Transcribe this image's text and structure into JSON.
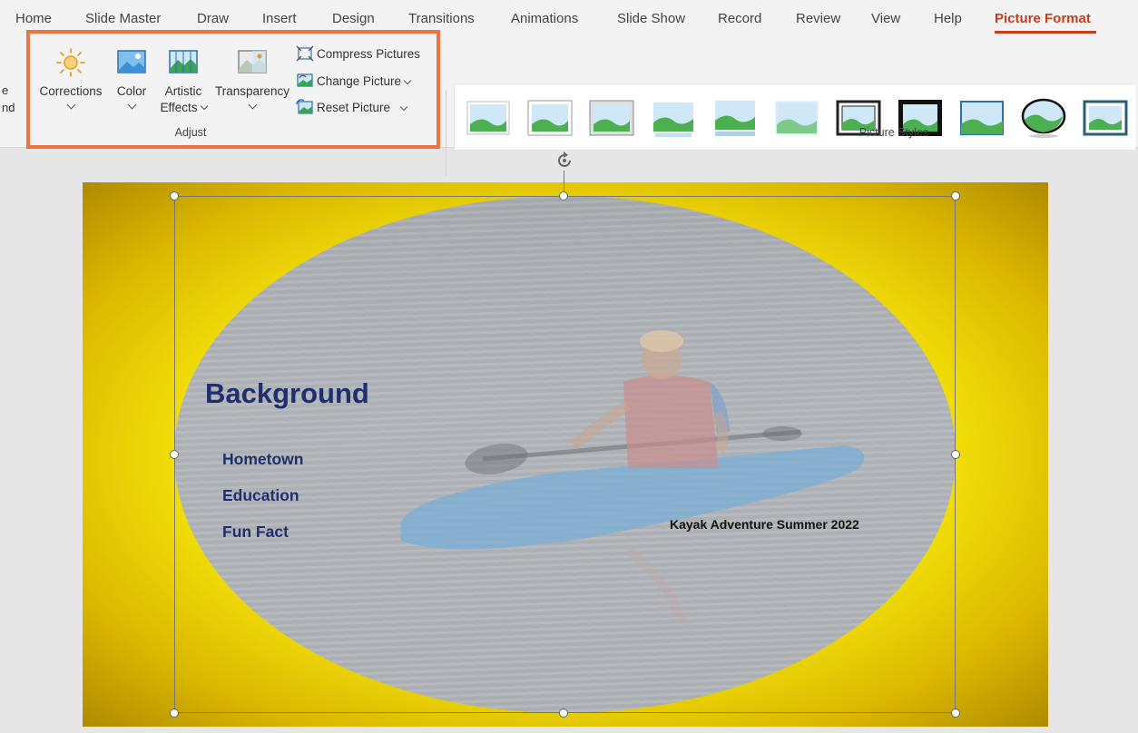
{
  "menu": {
    "tabs": [
      {
        "label": "Home"
      },
      {
        "label": "Slide Master"
      },
      {
        "label": "Draw"
      },
      {
        "label": "Insert"
      },
      {
        "label": "Design"
      },
      {
        "label": "Transitions"
      },
      {
        "label": "Animations"
      },
      {
        "label": "Slide Show"
      },
      {
        "label": "Record"
      },
      {
        "label": "Review"
      },
      {
        "label": "View"
      },
      {
        "label": "Help"
      },
      {
        "label": "Picture Format"
      }
    ],
    "active_tab": "Picture Format"
  },
  "ribbon": {
    "cut_off_labels": [
      "e",
      "nd"
    ],
    "adjust": {
      "group_label": "Adjust",
      "corrections": "Corrections",
      "color": "Color",
      "artistic_effects_line1": "Artistic",
      "artistic_effects_line2": "Effects",
      "transparency": "Transparency",
      "compress_pictures": "Compress Pictures",
      "change_picture": "Change Picture",
      "reset_picture": "Reset Picture"
    },
    "picture_styles": {
      "group_label": "Picture Styles",
      "style_count": 11
    }
  },
  "slide": {
    "heading": "Background",
    "bullets": [
      "Hometown",
      "Education",
      "Fun Fact"
    ],
    "caption": "Kayak Adventure Summer 2022"
  },
  "colors": {
    "accent_tab": "#c43e1c",
    "highlight_box": "#ee7340",
    "slide_text": "#1f2f6e",
    "slide_background": "#fff200"
  }
}
